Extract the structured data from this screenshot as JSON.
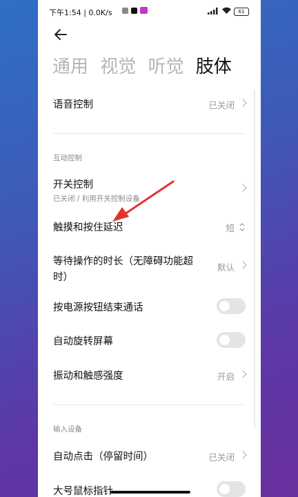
{
  "status_bar": {
    "time": "下午1:54 | 0.0K/s",
    "signal": "HD",
    "battery": "61"
  },
  "tabs": [
    {
      "label": "通用",
      "active": false
    },
    {
      "label": "视觉",
      "active": false
    },
    {
      "label": "听觉",
      "active": false
    },
    {
      "label": "肢体",
      "active": true
    }
  ],
  "items": {
    "voice_control": {
      "title": "语音控制",
      "value": "已关闭"
    },
    "switch_control": {
      "title": "开关控制",
      "subtitle": "已关闭 / 利用开关控制设备"
    },
    "touch_hold_delay": {
      "title": "触摸和按住延迟",
      "value": "短"
    },
    "action_time": {
      "title_line1": "等待操作的时长（无障碍功能超",
      "title_line2": "时）",
      "value": "默认"
    },
    "power_end_call": {
      "title": "按电源按钮结束通话",
      "on": false
    },
    "auto_rotate": {
      "title": "自动旋转屏幕",
      "on": false
    },
    "vibration": {
      "title": "振动和触感强度",
      "value": "开启"
    },
    "auto_click": {
      "title": "自动点击（停留时间）",
      "value": "已关闭"
    },
    "large_pointer": {
      "title": "大号鼠标指针",
      "on": false
    }
  },
  "sections": {
    "interaction": "互动控制",
    "input": "输入设备"
  },
  "colors": {
    "annotation_arrow": "#e0342a",
    "toggle_off": "#e4e4e4",
    "value_text": "#999999"
  }
}
